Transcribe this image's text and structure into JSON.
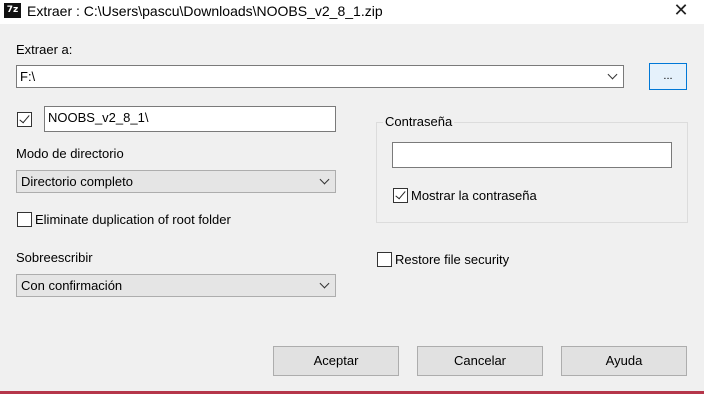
{
  "window": {
    "title": "Extraer : C:\\Users\\pascu\\Downloads\\NOOBS_v2_8_1.zip",
    "app_icon_text": "7z",
    "close_glyph": "✕"
  },
  "extract_to": {
    "label": "Extraer a:",
    "value": "F:\\",
    "browse_label": "..."
  },
  "subfolder": {
    "checked": true,
    "value": "NOOBS_v2_8_1\\"
  },
  "directory_mode": {
    "label": "Modo de directorio",
    "selected": "Directorio completo"
  },
  "eliminate_duplication": {
    "label": "Eliminate duplication of root folder",
    "checked": false
  },
  "overwrite": {
    "label": "Sobreescribir",
    "selected": "Con confirmación"
  },
  "password": {
    "group_label": "Contraseña",
    "value": "",
    "show_label": "Mostrar la contraseña",
    "show_checked": true
  },
  "restore_security": {
    "label": "Restore file security",
    "checked": false
  },
  "buttons": {
    "ok": "Aceptar",
    "cancel": "Cancelar",
    "help": "Ayuda"
  },
  "colors": {
    "background": "#f0f0f0",
    "focus_border": "#0078d7",
    "bottom_accent": "#b5364a"
  }
}
